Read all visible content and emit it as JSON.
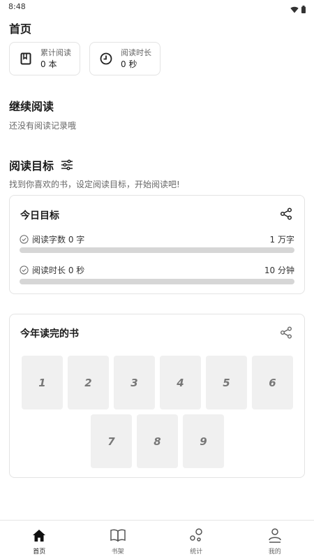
{
  "status_bar": {
    "time": "8:48"
  },
  "header": {
    "title": "首页"
  },
  "stats": [
    {
      "label": "累计阅读",
      "value": "0 本",
      "icon": "book-icon"
    },
    {
      "label": "阅读时长",
      "value": "0 秒",
      "icon": "clock-icon"
    }
  ],
  "continue_reading": {
    "title": "继续阅读",
    "empty_text": "还没有阅读记录哦"
  },
  "reading_goal": {
    "title": "阅读目标",
    "subtitle": "找到你喜欢的书，设定阅读目标，开始阅读吧!"
  },
  "today_goal": {
    "title": "今日目标",
    "rows": [
      {
        "label": "阅读字数 0 字",
        "target": "1 万字",
        "progress": 0
      },
      {
        "label": "阅读时长 0 秒",
        "target": "10 分钟",
        "progress": 0
      }
    ]
  },
  "books_this_year": {
    "title": "今年读完的书",
    "slots": [
      "1",
      "2",
      "3",
      "4",
      "5",
      "6",
      "7",
      "8",
      "9"
    ]
  },
  "bottom_nav": [
    {
      "label": "首页",
      "icon": "home-icon",
      "active": true
    },
    {
      "label": "书架",
      "icon": "bookshelf-icon",
      "active": false
    },
    {
      "label": "统计",
      "icon": "stats-icon",
      "active": false
    },
    {
      "label": "我的",
      "icon": "profile-icon",
      "active": false
    }
  ],
  "colors": {
    "progress_track": "#d6d6d6",
    "card_border": "#e3e3e3",
    "slot_bg": "#f0f0f0"
  }
}
